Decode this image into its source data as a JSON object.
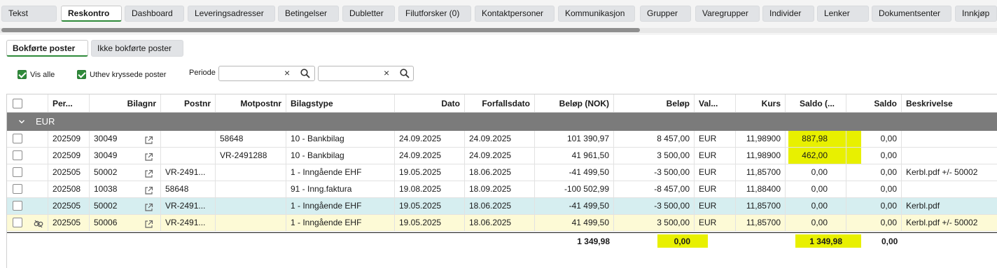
{
  "tabs": [
    {
      "label": "Tekst",
      "active": false
    },
    {
      "label": "Reskontro",
      "active": true
    },
    {
      "label": "Dashboard",
      "active": false
    },
    {
      "label": "Leveringsadresser",
      "active": false
    },
    {
      "label": "Betingelser",
      "active": false
    },
    {
      "label": "Dubletter",
      "active": false
    },
    {
      "label": "Filutforsker (0)",
      "active": false
    },
    {
      "label": "Kontaktpersoner",
      "active": false
    },
    {
      "label": "Kommunikasjon",
      "active": false
    },
    {
      "label": "Grupper",
      "active": false
    },
    {
      "label": "Varegrupper",
      "active": false
    },
    {
      "label": "Individer",
      "active": false
    },
    {
      "label": "Lenker",
      "active": false
    },
    {
      "label": "Dokumentsenter",
      "active": false
    },
    {
      "label": "Innkjøp",
      "active": false
    }
  ],
  "subtabs": [
    {
      "label": "Bokførte poster",
      "active": true
    },
    {
      "label": "Ikke bokførte poster",
      "active": false
    }
  ],
  "filters": {
    "vis_alle": {
      "label": "Vis alle",
      "checked": true
    },
    "uthev": {
      "label": "Uthev kryssede poster",
      "checked": true
    },
    "periode_label": "Periode",
    "periode_from": "",
    "periode_to": ""
  },
  "grid": {
    "columns": [
      "Per...",
      "Bilagnr",
      "Postnr",
      "Motpostnr",
      "Bilagstype",
      "Dato",
      "Forfallsdato",
      "Beløp (NOK)",
      "Beløp",
      "Val...",
      "Kurs",
      "Saldo (...",
      "Saldo",
      "Beskrivelse"
    ],
    "group_label": "EUR",
    "rows": [
      {
        "per": "202509",
        "bilagnr": "30049",
        "postnr": "",
        "motpostnr": "58648",
        "bilagstype": "10 - Bankbilag",
        "dato": "24.09.2025",
        "forfall": "24.09.2025",
        "belop_nok": "101 390,97",
        "belop": "8 457,00",
        "val": "EUR",
        "kurs": "11,98900",
        "saldo_nok": "887,98",
        "saldo": "0,00",
        "beskrivelse": "",
        "style": "normal",
        "saldo_nok_highlight": true
      },
      {
        "per": "202509",
        "bilagnr": "30049",
        "postnr": "",
        "motpostnr": "VR-2491288",
        "bilagstype": "10 - Bankbilag",
        "dato": "24.09.2025",
        "forfall": "24.09.2025",
        "belop_nok": "41 961,50",
        "belop": "3 500,00",
        "val": "EUR",
        "kurs": "11,98900",
        "saldo_nok": "462,00",
        "saldo": "0,00",
        "beskrivelse": "",
        "style": "normal",
        "saldo_nok_highlight": true
      },
      {
        "per": "202505",
        "bilagnr": "50002",
        "postnr": "VR-2491...",
        "motpostnr": "",
        "bilagstype": "1 - Inngående EHF",
        "dato": "19.05.2025",
        "forfall": "18.06.2025",
        "belop_nok": "-41 499,50",
        "belop": "-3 500,00",
        "val": "EUR",
        "kurs": "11,85700",
        "saldo_nok": "0,00",
        "saldo": "0,00",
        "beskrivelse": "Kerbl.pdf +/- 50002",
        "style": "normal",
        "saldo_nok_highlight": false
      },
      {
        "per": "202508",
        "bilagnr": "10038",
        "postnr": "58648",
        "motpostnr": "",
        "bilagstype": "91 - Inng.faktura",
        "dato": "19.08.2025",
        "forfall": "18.09.2025",
        "belop_nok": "-100 502,99",
        "belop": "-8 457,00",
        "val": "EUR",
        "kurs": "11,88400",
        "saldo_nok": "0,00",
        "saldo": "0,00",
        "beskrivelse": "",
        "style": "normal",
        "saldo_nok_highlight": false
      },
      {
        "per": "202505",
        "bilagnr": "50002",
        "postnr": "VR-2491...",
        "motpostnr": "",
        "bilagstype": "1 - Inngående EHF",
        "dato": "19.05.2025",
        "forfall": "18.06.2025",
        "belop_nok": "-41 499,50",
        "belop": "-3 500,00",
        "val": "EUR",
        "kurs": "11,85700",
        "saldo_nok": "0,00",
        "saldo": "0,00",
        "beskrivelse": "Kerbl.pdf",
        "style": "selected",
        "saldo_nok_highlight": false
      },
      {
        "per": "202505",
        "bilagnr": "50006",
        "postnr": "VR-2491...",
        "motpostnr": "",
        "bilagstype": "1 - Inngående EHF",
        "dato": "19.05.2025",
        "forfall": "18.06.2025",
        "belop_nok": "41 499,50",
        "belop": "3 500,00",
        "val": "EUR",
        "kurs": "11,85700",
        "saldo_nok": "0,00",
        "saldo": "0,00",
        "beskrivelse": "Kerbl.pdf +/- 50002",
        "style": "highlight",
        "saldo_nok_highlight": false,
        "unlink_icon": true
      }
    ],
    "totals": {
      "belop_nok": "1 349,98",
      "belop": "0,00",
      "saldo_nok": "1 349,98",
      "saldo": "0,00"
    }
  },
  "colors": {
    "accent_green": "#2f8a3a",
    "highlight_yellow": "#e8f000",
    "selected_row": "#d6eef0",
    "highlight_row": "#fdfad6",
    "group_bar": "#7b7b7b"
  },
  "icons": {
    "clear": "×",
    "search": "search-icon",
    "external_link": "external-link-icon",
    "unlink": "unlink-icon",
    "group_chevron": "chevron-down-icon"
  }
}
